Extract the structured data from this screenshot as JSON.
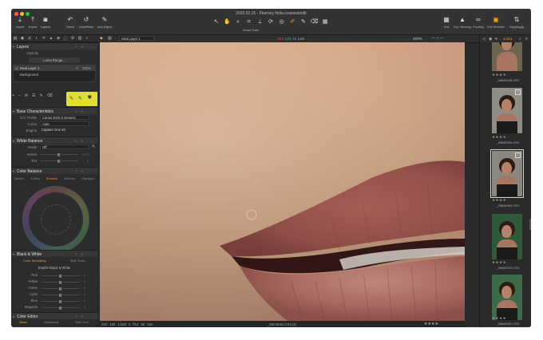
{
  "window": {
    "title": "2020.02.15 - Fberney Nola.cosessiondb",
    "traffic_lights": [
      "#ff5f57",
      "#febc2e",
      "#28c840"
    ]
  },
  "toolbar": {
    "left": [
      {
        "icon": "import-icon",
        "label": "Import"
      },
      {
        "icon": "export-icon",
        "label": "Export"
      },
      {
        "icon": "capture-icon",
        "label": "Capture"
      },
      {
        "icon": "reset-icon",
        "label": "Reset"
      },
      {
        "icon": "undo-redo-icon",
        "label": "Undo/Redo"
      },
      {
        "icon": "auto-adjust-icon",
        "label": "Auto Adjust"
      }
    ],
    "cursor_tools_label": "Cursor Tools",
    "right": [
      {
        "icon": "grid-icon",
        "label": "Grid"
      },
      {
        "icon": "exposure-warning-icon",
        "label": "Exp. Warning"
      },
      {
        "icon": "proofing-icon",
        "label": "Proofing"
      },
      {
        "icon": "edit-selected-icon",
        "label": "Edit Selected"
      },
      {
        "icon": "copy-apply-icon",
        "label": "Copy/Apply"
      }
    ]
  },
  "layers": {
    "title": "Layers",
    "opacity_label": "Opacity",
    "luma_range_button": "Luma Range...",
    "items": [
      {
        "name": "Heal Layer 1",
        "opacity": "100%"
      },
      {
        "name": "Background"
      }
    ]
  },
  "base_characteristics": {
    "title": "Base Characteristics",
    "rows": [
      {
        "label": "ICC Profile",
        "value": "Canon EOS 5 Generic"
      },
      {
        "label": "Curve",
        "value": "Auto"
      },
      {
        "label": "Engine",
        "value": "Capture One 20"
      }
    ]
  },
  "white_balance": {
    "title": "White Balance",
    "mode_label": "Mode",
    "mode_value": "Off",
    "kelvin_label": "Kelvin",
    "kelvin_value": "6000",
    "tint_label": "Tint",
    "tint_value": "0"
  },
  "color_balance": {
    "title": "Color Balance",
    "tabs": [
      "Master",
      "3-Way",
      "Shadow",
      "Midtone",
      "Highlight"
    ],
    "active_tab": "Shadow"
  },
  "black_white": {
    "title": "Black & White",
    "tabs": [
      "Color Sensitivity",
      "Split Tones"
    ],
    "enable_label": "Enable Black & White",
    "channels": [
      {
        "label": "Red",
        "value": "0"
      },
      {
        "label": "Yellow",
        "value": "0"
      },
      {
        "label": "Green",
        "value": "0"
      },
      {
        "label": "Cyan",
        "value": "0"
      },
      {
        "label": "Blue",
        "value": "0"
      },
      {
        "label": "Magenta",
        "value": "0"
      }
    ]
  },
  "color_editor": {
    "title": "Color Editor",
    "tabs": [
      "Basic",
      "Advanced",
      "Skin Tone"
    ]
  },
  "viewer": {
    "layer_select": "Heal Layer 1",
    "rgb": {
      "r": "183",
      "g": "133",
      "b": "95",
      "l": "144"
    },
    "zoom": "400%",
    "exif": "ISO 160   1/160 s   f/14   50 mm",
    "filename": "_NBA5054.CR3 (2)",
    "stars": "★★★★·"
  },
  "filmstrip": {
    "counter": "1/161",
    "items": [
      {
        "file": "_NBA5048.CR3",
        "stars": "★★★★·",
        "selected": false
      },
      {
        "file": "_NBA5054.CR3",
        "stars": "★★★★·",
        "selected": false,
        "badge": "1"
      },
      {
        "file": "_NBA5054.CR3",
        "stars": "★★★★·",
        "selected": true,
        "badge": "2"
      },
      {
        "file": "_NBA5060.CR3",
        "stars": "★★★★·",
        "selected": false
      },
      {
        "file": "_NBA5061.CR3",
        "stars": "★★★★·",
        "selected": false
      }
    ]
  },
  "colors": {
    "accent": "#f0a020",
    "highlight": "#dede34",
    "panel": "#2c2c2c"
  }
}
